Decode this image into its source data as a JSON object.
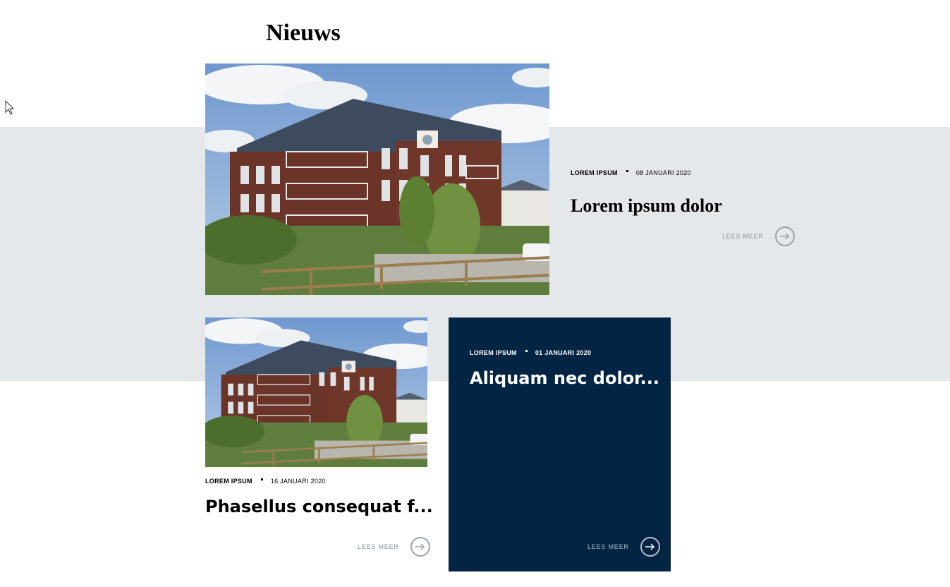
{
  "page": {
    "title": "Nieuws"
  },
  "articles": [
    {
      "category": "LOREM IPSUM",
      "date": "08 JANUARI 2020",
      "title": "Lorem ipsum dolor",
      "read_more": "LEES MEER",
      "image": "apartment-building-render"
    },
    {
      "category": "LOREM IPSUM",
      "date": "16 JANUARI 2020",
      "title": "Phasellus consequat f...",
      "read_more": "LEES MEER",
      "image": "apartment-building-render"
    },
    {
      "category": "LOREM IPSUM",
      "date": "01 JANUARI 2020",
      "title": "Aliquam nec dolor...",
      "read_more": "LEES MEER"
    }
  ],
  "icons": {
    "read_more": "arrow-right-icon",
    "cursor": "mouse-pointer-icon"
  },
  "colors": {
    "band": "#e5e8eb",
    "navy": "#042444",
    "muted": "#8a8f95"
  }
}
